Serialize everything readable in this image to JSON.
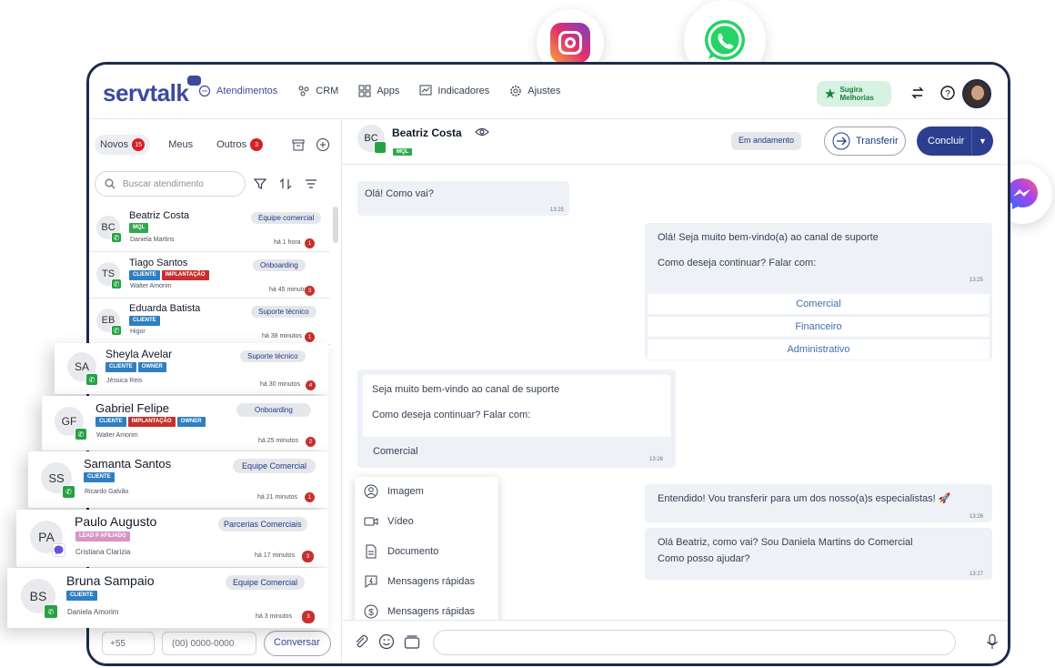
{
  "brand": {
    "name": "servtalk"
  },
  "nav": [
    {
      "label": "Atendimentos",
      "icon": "chat-icon"
    },
    {
      "label": "CRM",
      "icon": "crm-icon"
    },
    {
      "label": "Apps",
      "icon": "grid-icon"
    },
    {
      "label": "Indicadores",
      "icon": "chart-icon"
    },
    {
      "label": "Ajustes",
      "icon": "gear-icon"
    }
  ],
  "header": {
    "suggest_label_1": "Sugira",
    "suggest_label_2": "Melhorias"
  },
  "tabs": [
    {
      "label": "Novos",
      "count": "15"
    },
    {
      "label": "Meus",
      "count": ""
    },
    {
      "label": "Outros",
      "count": "3"
    }
  ],
  "search": {
    "placeholder": "Buscar atendimento"
  },
  "conversations": [
    {
      "initials": "BC",
      "name": "Beatriz Costa",
      "tags": [
        "MQL"
      ],
      "agent": "Daniela Martins",
      "dept": "Equipe comercial",
      "time": "há 1 hora",
      "count": "1"
    },
    {
      "initials": "TS",
      "name": "Tiago Santos",
      "tags": [
        "CLIENTE",
        "IMPLANTAÇÃO"
      ],
      "agent": "Walter Amorim",
      "dept": "Onboarding",
      "time": "há 45 minutos",
      "count": "3"
    },
    {
      "initials": "EB",
      "name": "Eduarda Batista",
      "tags": [
        "CLIENTE"
      ],
      "agent": "Higor",
      "dept": "Suporte técnico",
      "time": "há 38 minutos",
      "count": "1"
    },
    {
      "initials": "SA",
      "name": "Sheyla Avelar",
      "tags": [
        "CLIENTE",
        "OWNER"
      ],
      "agent": "Jéssica Reis",
      "dept": "Suporte técnico",
      "time": "há 30 minutos",
      "count": "4"
    },
    {
      "initials": "GF",
      "name": "Gabriel Felipe",
      "tags": [
        "CLIENTE",
        "IMPLANTAÇÃO",
        "OWNER"
      ],
      "agent": "Walter Amorim",
      "dept": "Onboarding",
      "time": "há 25 minutos",
      "count": "2"
    },
    {
      "initials": "SS",
      "name": "Samanta Santos",
      "tags": [
        "CLIENTE"
      ],
      "agent": "Ricardo Galvão",
      "dept": "Equipe Comercial",
      "time": "há 21 minutos",
      "count": "1"
    },
    {
      "initials": "PA",
      "name": "Paulo Augusto",
      "tags": [
        "LEAD P AFILIADO"
      ],
      "agent": "Cristiana Clarizia",
      "dept": "Parcerias Comerciais",
      "time": "há 17 minutos",
      "count": "3"
    },
    {
      "initials": "BS",
      "name": "Bruna Sampaio",
      "tags": [
        "CLIENTE"
      ],
      "agent": "Daniela Amorim",
      "dept": "Equipe Comercial",
      "time": "há 3 minutos",
      "count": "3"
    }
  ],
  "left_bottom": {
    "ddi": "+55",
    "phone_placeholder": "(00) 0000-0000",
    "start_label": "Conversar"
  },
  "chat": {
    "contact": {
      "initials": "BC",
      "name": "Beatriz Costa",
      "tag": "MQL"
    },
    "status": "Em andamento",
    "transfer_label": "Transferir",
    "conclude_label": "Concluir",
    "messages": {
      "m1": {
        "text": "Olá! Como vai?",
        "time": "13:25"
      },
      "m2": {
        "line1": "Olá! Seja muito bem-vindo(a) ao canal de suporte",
        "line2": "Como deseja continuar? Falar com:",
        "time": "13:25"
      },
      "options": [
        "Comercial",
        "Financeiro",
        "Administrativo"
      ],
      "m3": {
        "line1": "Seja muito bem-vindo ao canal de suporte",
        "line2": "Como deseja continuar? Falar com:",
        "reply": "Comercial",
        "time": "13:26"
      },
      "m4": {
        "text": "Entendido! Vou transferir para um dos nosso(a)s especialistas! 🚀",
        "time": "13:26"
      },
      "m5": {
        "line1": "Olá Beatriz, como vai? Sou Daniela Martins do Comercial",
        "line2": "Como posso ajudar?",
        "time": "13:27"
      }
    }
  },
  "attach_menu": [
    {
      "label": "Imagem",
      "icon": "user-circle-icon"
    },
    {
      "label": "Vídeo",
      "icon": "video-icon"
    },
    {
      "label": "Documento",
      "icon": "document-icon"
    },
    {
      "label": "Mensagens rápidas",
      "icon": "quick-message-icon"
    },
    {
      "label": "Mensagens rápidas",
      "icon": "dollar-icon"
    }
  ],
  "colors": {
    "brand": "#3c4a9e",
    "primary_button": "#2c3e8f",
    "whatsapp": "#25a244",
    "badge_red": "#d61f26"
  }
}
